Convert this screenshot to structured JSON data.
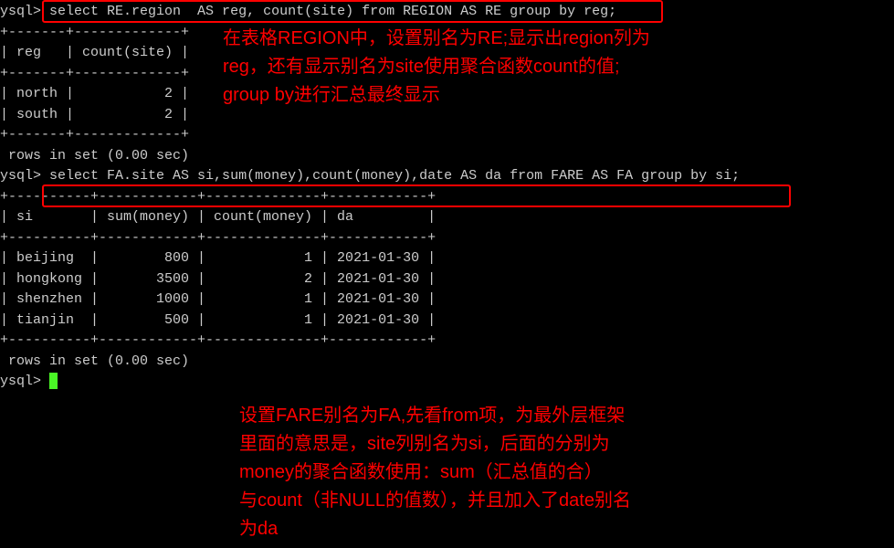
{
  "prompt_label": "ysql>",
  "query1": {
    "sql": "select RE.region  AS reg, count(site) from REGION AS RE group by reg;",
    "header_row": "| reg   | count(site) |",
    "divider": "+-------+-------------+",
    "rows": [
      "| north |           2 |",
      "| south |           2 |"
    ],
    "status": " rows in set (0.00 sec)"
  },
  "query2": {
    "sql": "select FA.site AS si,sum(money),count(money),date AS da from FARE AS FA group by si;",
    "header_row": "| si       | sum(money) | count(money) | da         |",
    "divider": "+----------+------------+--------------+------------+",
    "rows": [
      "| beijing  |        800 |            1 | 2021-01-30 |",
      "| hongkong |       3500 |            2 | 2021-01-30 |",
      "| shenzhen |       1000 |            1 | 2021-01-30 |",
      "| tianjin  |        500 |            1 | 2021-01-30 |"
    ],
    "status": " rows in set (0.00 sec)"
  },
  "annotations": {
    "a1_line1": "在表格REGION中，设置别名为RE;显示出region列为",
    "a1_line2": "reg，还有显示别名为site使用聚合函数count的值;",
    "a1_line3": "group by进行汇总最终显示",
    "a2_line1": "设置FARE别名为FA,先看from项，为最外层框架",
    "a2_line2": "里面的意思是，site列别名为si，后面的分别为",
    "a2_line3": "money的聚合函数使用：sum（汇总值的合）",
    "a2_line4": "与count（非NULL的值数），并且加入了date别名",
    "a2_line5": "为da"
  },
  "blank": ""
}
